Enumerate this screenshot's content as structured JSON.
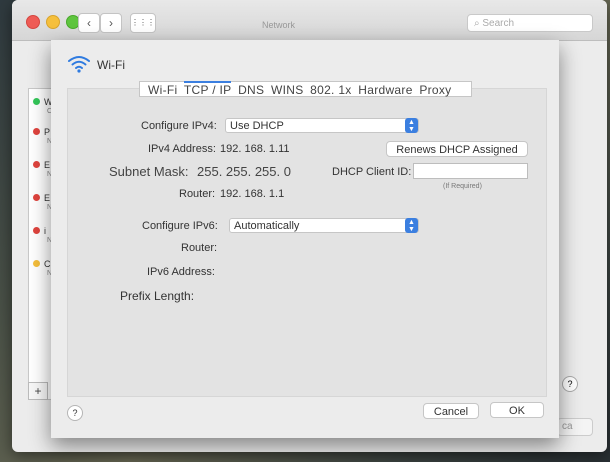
{
  "window": {
    "title": "Network",
    "search_placeholder": "Search",
    "back_glyph": "‹",
    "forward_glyph": "›",
    "grid_glyph": "⋮⋮⋮",
    "add_glyph": "+",
    "help_glyph": "?",
    "bg_button_label": "ca"
  },
  "sidebar": {
    "items": [
      {
        "initial": "W",
        "sub": "C",
        "color": "#34c759"
      },
      {
        "initial": "P",
        "sub": "N",
        "color": "#e0443e"
      },
      {
        "initial": "E",
        "sub": "N",
        "color": "#e0443e"
      },
      {
        "initial": "E",
        "sub": "N",
        "color": "#e0443e"
      },
      {
        "initial": "i",
        "sub": "N",
        "color": "#e0443e"
      },
      {
        "initial": "C",
        "sub": "N",
        "color": "#f5bf3c"
      }
    ]
  },
  "sheet": {
    "title": "Wi-Fi",
    "tabs": [
      "Wi-Fi",
      "TCP / IP",
      "DNS",
      "WINS",
      "802. 1x",
      "Hardware",
      "Proxy"
    ],
    "active_tab": "TCP / IP",
    "configure_ipv4_label": "Configure IPv4:",
    "configure_ipv4_value": "Use DHCP",
    "ipv4_address_label": "IPv4 Address:",
    "ipv4_address_value": "192. 168. 1.11",
    "renew_button": "Renews DHCP Assigned",
    "subnet_mask_label": "Subnet Mask:",
    "subnet_mask_value": "255. 255. 255. 0",
    "dhcp_client_id_label": "DHCP Client ID:",
    "dhcp_client_id_value": "",
    "dhcp_hint": "(If Required)",
    "router_label": "Router:",
    "router_value": "192. 168. 1.1",
    "configure_ipv6_label": "Configure IPv6:",
    "configure_ipv6_value": "Automatically",
    "router6_label": "Router:",
    "ipv6_address_label": "IPv6 Address:",
    "prefix_length_label": "Prefix Length:",
    "cancel_button": "Cancel",
    "ok_button": "OK"
  },
  "colors": {
    "accent": "#3b7fe0",
    "wifi_icon": "#2f7be0"
  }
}
